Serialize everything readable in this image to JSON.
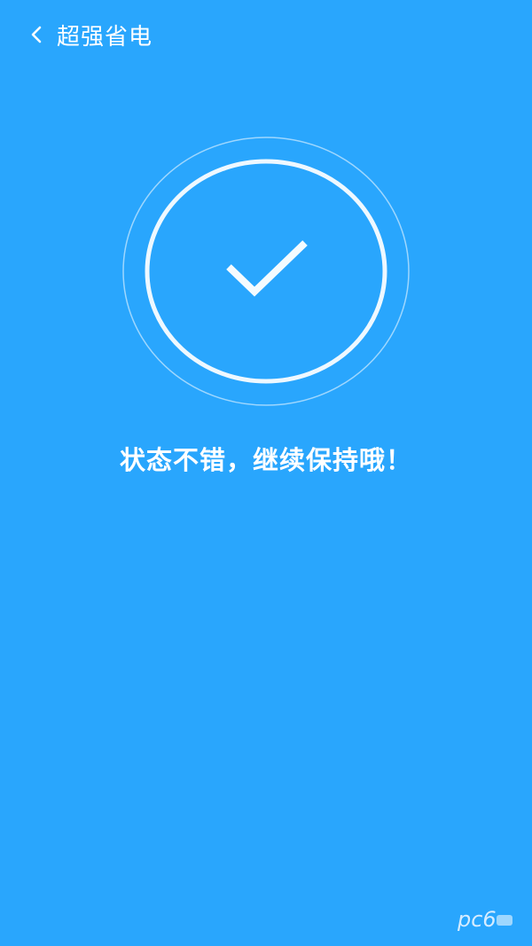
{
  "header": {
    "title": "超强省电",
    "back_icon": "chevron-left-icon"
  },
  "status": {
    "icon": "check-icon",
    "message": "状态不错，继续保持哦！"
  },
  "watermark": {
    "text": "pc6"
  },
  "colors": {
    "background": "#29a6fd",
    "foreground": "#ffffff"
  }
}
